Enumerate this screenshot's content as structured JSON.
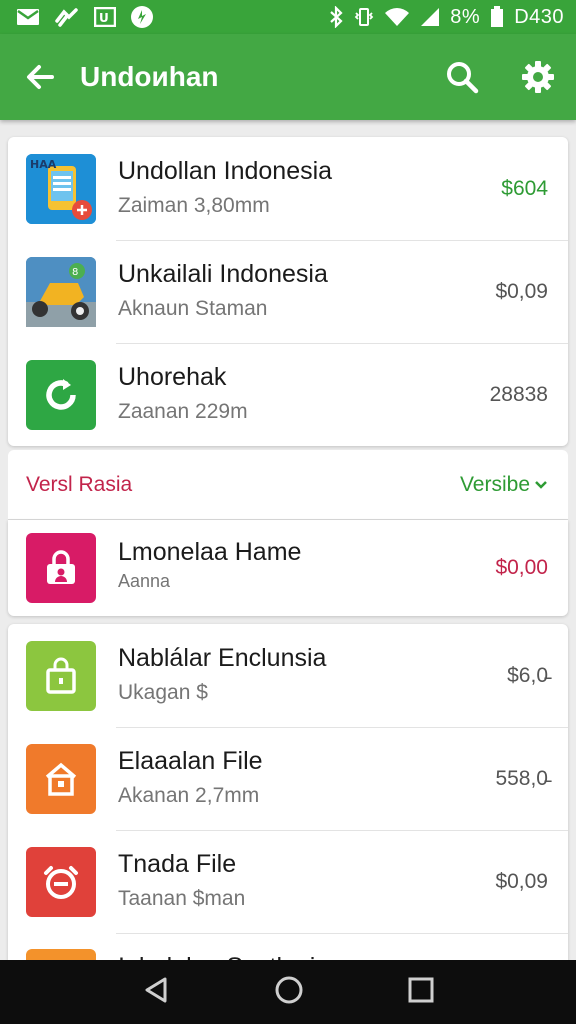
{
  "status_bar": {
    "battery": "8%",
    "time": "D430",
    "icons": [
      "mail-icon",
      "link-icon",
      "store-icon",
      "notification-icon",
      "bluetooth-icon",
      "vibrate-icon",
      "wifi-icon",
      "signal-icon",
      "battery-icon"
    ]
  },
  "app_bar": {
    "title": "Undoиhan",
    "icons": [
      "back-arrow-icon",
      "search-icon",
      "settings-gear-icon"
    ]
  },
  "list_top": [
    {
      "title": "Undollan Indonesia",
      "subtitle": "Zaiman  3,80mm",
      "price": "$604",
      "price_color": "#2e9b34",
      "icon": "phone-app-icon"
    },
    {
      "title": "Unkailali Indonesia",
      "subtitle": "Aknaun  Staman",
      "price": "$0,09",
      "price_color": "#555555",
      "icon": "scooter-app-icon"
    },
    {
      "title": "Uhorehak",
      "subtitle": "Zaanan  229m",
      "price": "28838",
      "price_color": "#555555",
      "icon": "refresh-app-icon"
    }
  ],
  "section": {
    "title": "Versl Rasia",
    "filter": "Versibe"
  },
  "featured": {
    "title": "Lmonelaa Hame",
    "subtitle": "Aanna",
    "price": "$0,00",
    "price_color": "#c2244b",
    "icon": "lock-app-icon"
  },
  "list_bottom": [
    {
      "title": "Nablálar Enclunsia",
      "subtitle": "Ukagan  $",
      "price": "$6,0̵",
      "price_color": "#555555",
      "icon": "bag-app-icon"
    },
    {
      "title": "Elaaalan File",
      "subtitle": "Akanan  2,7mm",
      "price": "558,0̵",
      "price_color": "#555555",
      "icon": "home-app-icon"
    },
    {
      "title": "Tnada File",
      "subtitle": "Taanan  $man",
      "price": "$0,09",
      "price_color": "#555555",
      "icon": "timer-app-icon"
    },
    {
      "title": "Iuhalalan Sastlania",
      "subtitle": "",
      "price": "",
      "price_color": "#555555",
      "icon": "orange-app-icon"
    }
  ],
  "colors": {
    "status_bar": "#39a43a",
    "app_bar": "#43a844",
    "accent_green": "#2e9b34",
    "accent_red": "#c2244b",
    "background": "#ececec"
  },
  "nav_bar": {
    "icons": [
      "nav-back-icon",
      "nav-home-icon",
      "nav-recents-icon"
    ]
  }
}
